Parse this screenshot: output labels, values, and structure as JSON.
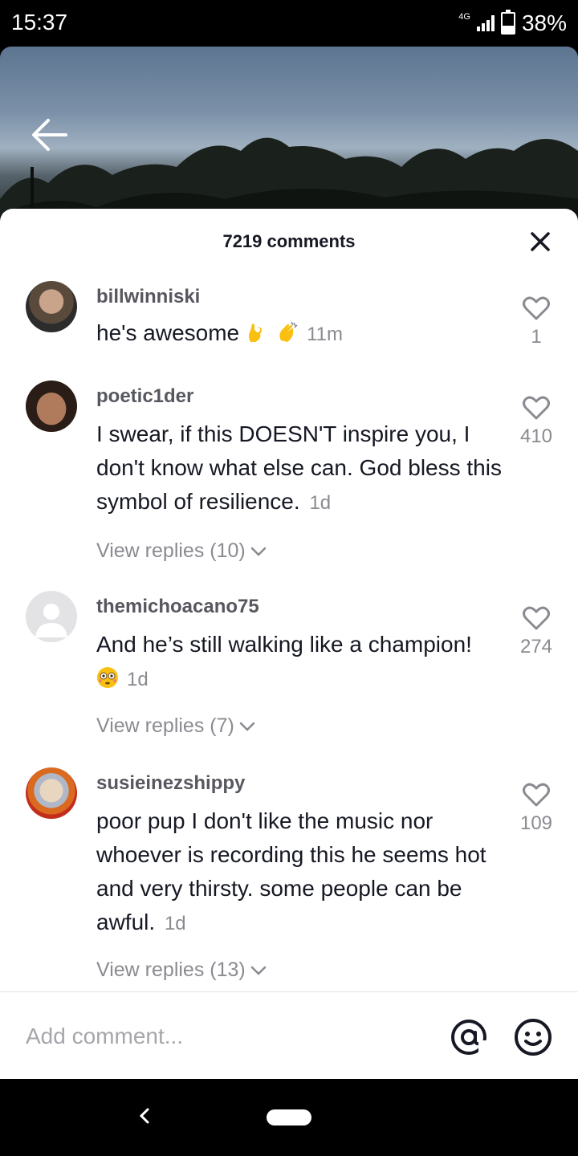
{
  "status": {
    "time": "15:37",
    "network": "4G",
    "battery_pct": "38%",
    "battery_level": 0.38
  },
  "header": {
    "comments_count": "7219 comments"
  },
  "comments": [
    {
      "username": "billwinniski",
      "text": "he's awesome",
      "emojis": [
        "ok-hand-emoji",
        "clapping-hands-emoji"
      ],
      "time": "11m",
      "likes": "1",
      "replies": ""
    },
    {
      "username": "poetic1der",
      "text": "I swear, if this DOESN'T inspire you, I don't know what else can. God bless this symbol of resilience.",
      "time": "1d",
      "likes": "410",
      "replies": "View replies (10)"
    },
    {
      "username": "themichoacano75",
      "text": "And he’s still walking like a champion!",
      "emojis": [
        "flushed-face-emoji"
      ],
      "time": "1d",
      "likes": "274",
      "replies": "View replies (7)"
    },
    {
      "username": "susieinezshippy",
      "text": "poor pup I don't like the music nor whoever is recording this he seems hot and very thirsty. some people can be awful.",
      "time": "1d",
      "likes": "109",
      "replies": "View replies (13)"
    }
  ],
  "input": {
    "placeholder": "Add comment..."
  },
  "colors": {
    "text_primary": "#161823",
    "text_secondary": "#8a8b91",
    "username": "#57585f"
  }
}
